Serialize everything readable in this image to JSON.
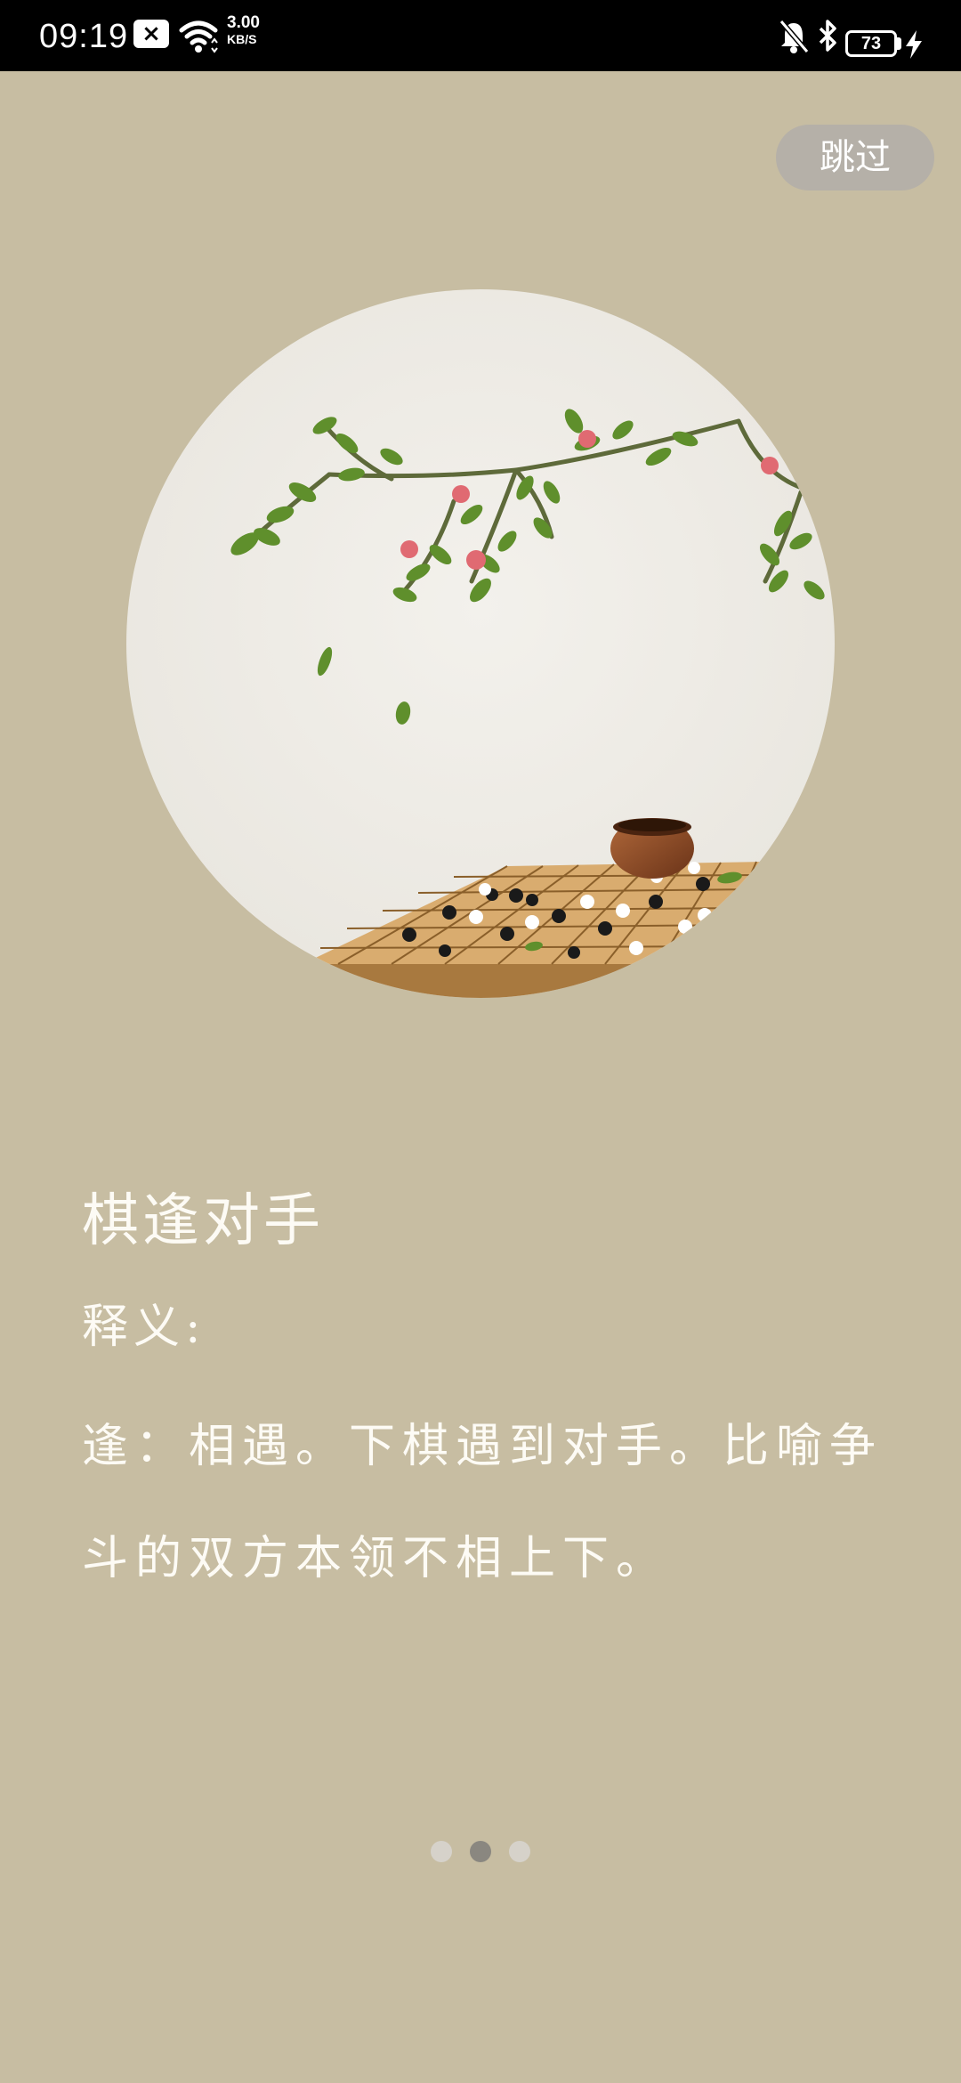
{
  "status_bar": {
    "time": "09:19",
    "net_speed_value": "3.00",
    "net_speed_unit": "KB/S",
    "battery_level": "73"
  },
  "skip_button": {
    "label": "跳过"
  },
  "content": {
    "title": "棋逢对手",
    "meaning_label": "释义:",
    "meaning_text": "逢：相遇。下棋遇到对手。比喻争斗的双方本领不相上下。"
  },
  "pager": {
    "count": 3,
    "active_index": 1
  },
  "colors": {
    "background": "#c7bda2",
    "circle": "#efede8",
    "text": "#fdfbf5",
    "skip_button": "#b5b0a8",
    "dot_active": "#8a8780",
    "dot_inactive": "#d6d2ca"
  }
}
